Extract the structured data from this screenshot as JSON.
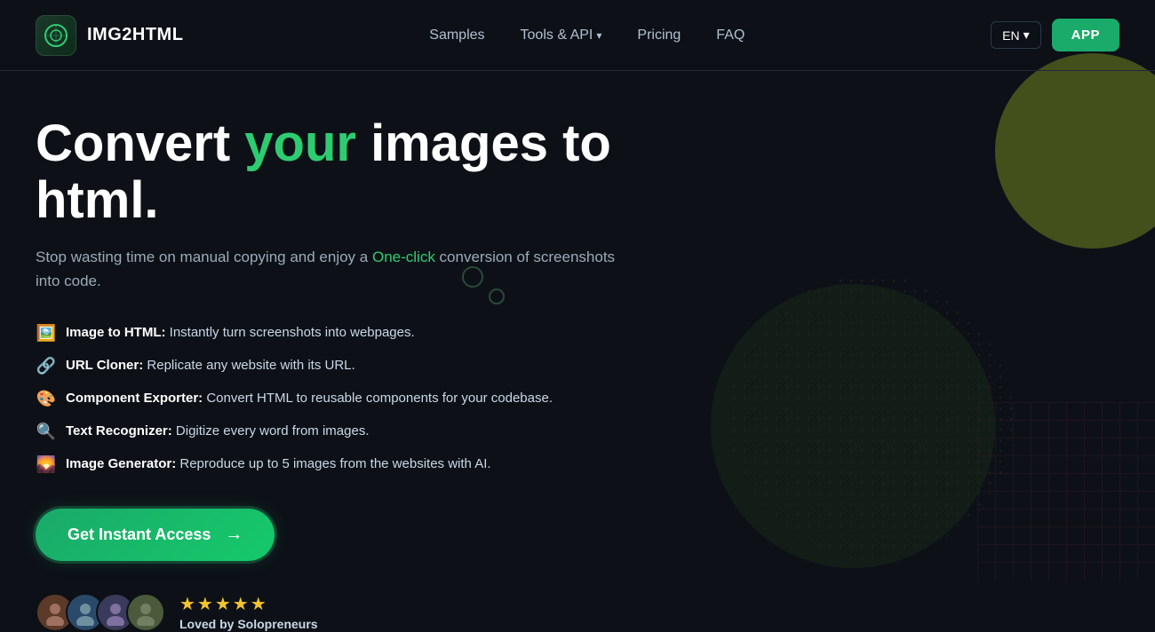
{
  "nav": {
    "logo_icon": "🌀",
    "logo_text": "IMG2HTML",
    "links": [
      {
        "label": "Samples",
        "dropdown": false
      },
      {
        "label": "Tools & API",
        "dropdown": true
      },
      {
        "label": "Pricing",
        "dropdown": false
      },
      {
        "label": "FAQ",
        "dropdown": false
      }
    ],
    "lang": "EN",
    "app_button": "APP"
  },
  "hero": {
    "title_before": "Convert ",
    "title_highlight": "your",
    "title_after": " images to html.",
    "subtitle_before": "Stop wasting time on manual copying and enjoy a ",
    "subtitle_link": "One-click",
    "subtitle_after": " conversion of screenshots into code."
  },
  "features": [
    {
      "emoji": "🖼️",
      "bold": "Image to HTML:",
      "text": " Instantly turn screenshots into webpages."
    },
    {
      "emoji": "🔗",
      "bold": "URL Cloner:",
      "text": " Replicate any website with its URL."
    },
    {
      "emoji": "🎨",
      "bold": "Component Exporter:",
      "text": " Convert HTML to reusable components for your codebase."
    },
    {
      "emoji": "🔍",
      "bold": "Text Recognizer:",
      "text": " Digitize every word from images."
    },
    {
      "emoji": "🖼️",
      "bold": "Image Generator:",
      "text": " Reproduce up to 5 images from the websites with AI."
    }
  ],
  "cta": {
    "label": "Get Instant Access",
    "arrow": "→"
  },
  "social_proof": {
    "stars": "★★★★★",
    "label": "Loved by Solopreneurs",
    "avatars": [
      "👤",
      "👤",
      "👤",
      "👤"
    ]
  }
}
